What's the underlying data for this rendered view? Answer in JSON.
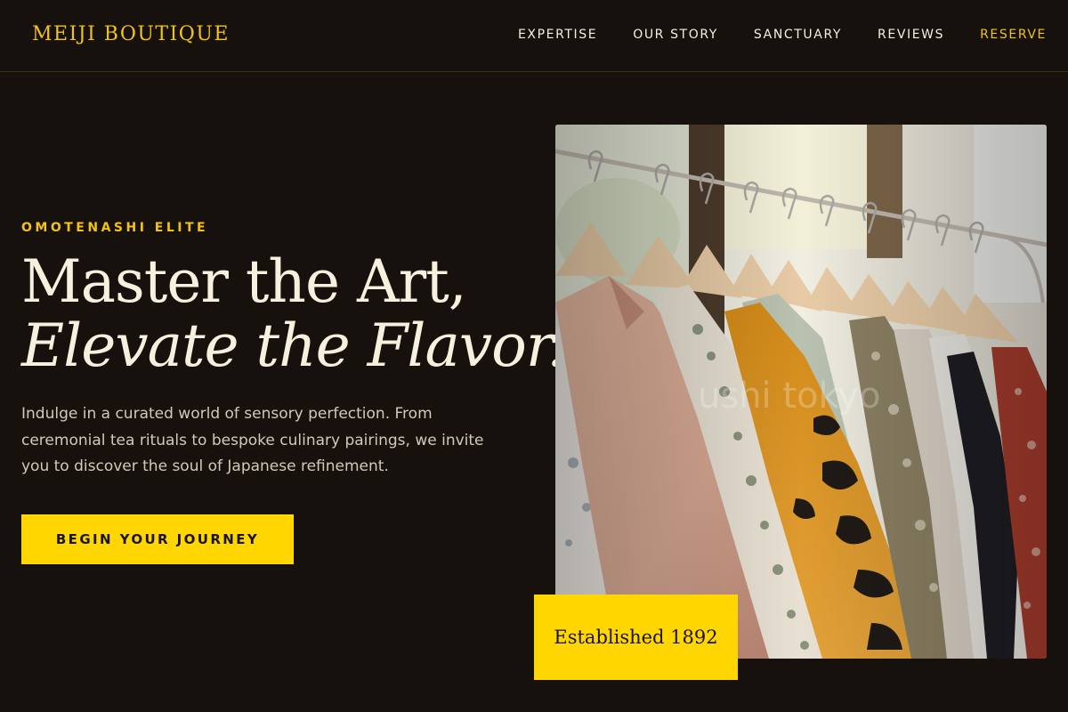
{
  "brand": {
    "name": "MEIJI BOUTIQUE"
  },
  "nav": {
    "items": [
      {
        "label": "EXPERTISE"
      },
      {
        "label": "OUR STORY"
      },
      {
        "label": "SANCTUARY"
      },
      {
        "label": "REVIEWS"
      },
      {
        "label": "RESERVE"
      }
    ]
  },
  "hero": {
    "eyebrow": "OMOTENASHI ELITE",
    "headline_line1": "Master the Art,",
    "headline_line2": "Elevate the Flavor.",
    "lede": "Indulge in a curated world of sensory perfection. From ceremonial tea rituals to bespoke culinary pairings, we invite you to discover the soul of Japanese refinement.",
    "cta_label": "BEGIN YOUR JOURNEY",
    "image_watermark": "ushi tokyo",
    "badge": "Established 1892"
  },
  "colors": {
    "background": "#17110d",
    "accent": "#ffd600",
    "brand_gold": "#f2c40f",
    "text_light": "#f6f0df"
  }
}
